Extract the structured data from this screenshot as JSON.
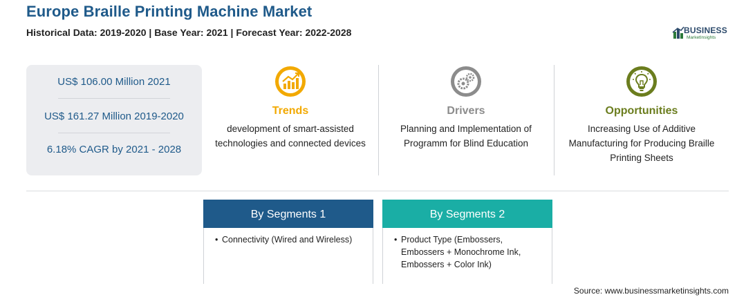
{
  "header": {
    "title": "Europe Braille Printing Machine Market",
    "subtitle": "Historical Data: 2019-2020 | Base Year: 2021 | Forecast Year: 2022-2028"
  },
  "logo": {
    "main": "BUSINESS",
    "sub": "MarketInsights"
  },
  "stats": [
    "US$ 106.00 Million 2021",
    "US$ 161.27 Million 2019-2020",
    "6.18% CAGR by 2021 - 2028"
  ],
  "features": [
    {
      "heading": "Trends",
      "icon": "chart-growth-icon",
      "color": "#f2a900",
      "description": "development of smart-assisted technologies and connected devices"
    },
    {
      "heading": "Drivers",
      "icon": "gears-icon",
      "color": "#8c8c8c",
      "description": "Planning and Implementation of Programm for Blind Education"
    },
    {
      "heading": "Opportunities",
      "icon": "lightbulb-icon",
      "color": "#6b7d1e",
      "description": "Increasing Use of Additive Manufacturing for Producing Braille Printing Sheets"
    }
  ],
  "segments": [
    {
      "title": "By Segments 1",
      "color": "#1f5a8a",
      "items": [
        "Connectivity (Wired and Wireless)"
      ]
    },
    {
      "title": "By Segments 2",
      "color": "#1aaea5",
      "items": [
        "Product Type (Embossers, Embossers + Monochrome Ink, Embossers + Color Ink)"
      ]
    }
  ],
  "source": "Source: www.businessmarketinsights.com"
}
